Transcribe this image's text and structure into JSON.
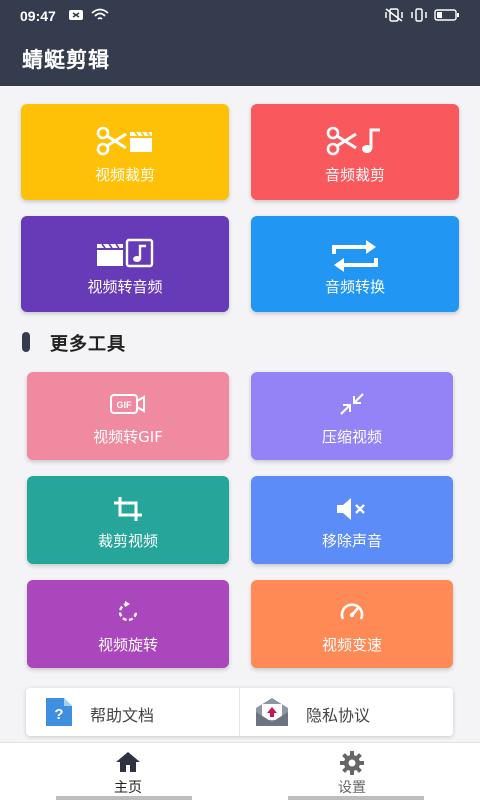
{
  "status": {
    "time": "09:47"
  },
  "app": {
    "title": "蜻蜓剪辑"
  },
  "main_tools": [
    {
      "label": "视频裁剪",
      "color": "#fec107",
      "icon": "scissors-clapper-icon"
    },
    {
      "label": "音频裁剪",
      "color": "#f9595d",
      "icon": "scissors-music-note-icon"
    },
    {
      "label": "视频转音频",
      "color": "#673ab7",
      "icon": "clapper-to-music-icon"
    },
    {
      "label": "音频转换",
      "color": "#2196f3",
      "icon": "repeat-arrows-icon"
    }
  ],
  "section": {
    "title": "更多工具"
  },
  "more_tools": [
    {
      "label": "视频转GIF",
      "color": "#f08aa0",
      "icon": "gif-camera-icon"
    },
    {
      "label": "压缩视频",
      "color": "#9383f7",
      "icon": "compress-arrows-icon"
    },
    {
      "label": "裁剪视频",
      "color": "#26a69a",
      "icon": "crop-icon"
    },
    {
      "label": "移除声音",
      "color": "#5c8cf7",
      "icon": "mute-speaker-icon"
    },
    {
      "label": "视频旋转",
      "color": "#ab47bc",
      "icon": "rotate-icon"
    },
    {
      "label": "视频变速",
      "color": "#ff8a55",
      "icon": "speedometer-icon"
    }
  ],
  "help": {
    "docs_label": "帮助文档",
    "privacy_label": "隐私协议"
  },
  "nav": {
    "home_label": "主页",
    "settings_label": "设置",
    "active_color": "#222222",
    "inactive_color": "#666666"
  }
}
